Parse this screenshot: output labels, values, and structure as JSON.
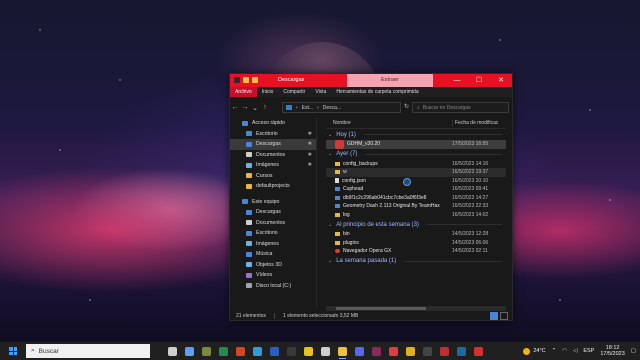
{
  "window": {
    "title": "Descargas",
    "context_tab": "Extraer",
    "controls": {
      "minimize": "—",
      "maximize": "☐",
      "close": "✕"
    }
  },
  "ribbon": {
    "tabs": [
      "Archivo",
      "Inicio",
      "Compartir",
      "Vista",
      "Herramientas de carpeta comprimida"
    ]
  },
  "address": {
    "parts": [
      "Est...",
      "Desca..."
    ],
    "search_placeholder": "Buscar en Descargas"
  },
  "sidebar": {
    "items": [
      {
        "label": "Acceso rápido",
        "icon": "star-icon",
        "color": "#4a86d8",
        "child": false,
        "pinned": false
      },
      {
        "label": "Escritorio",
        "icon": "desktop-icon",
        "color": "#4a86d8",
        "child": true,
        "pinned": true
      },
      {
        "label": "Descargas",
        "icon": "download-icon",
        "color": "#4a86d8",
        "child": true,
        "pinned": true,
        "selected": true
      },
      {
        "label": "Documentos",
        "icon": "document-icon",
        "color": "#cfcfcf",
        "child": true,
        "pinned": true
      },
      {
        "label": "Imágenes",
        "icon": "image-icon",
        "color": "#6fb0e6",
        "child": true,
        "pinned": true
      },
      {
        "label": "Cursos",
        "icon": "folder-icon",
        "color": "#e8b83e",
        "child": true,
        "pinned": false
      },
      {
        "label": "defaultprojects",
        "icon": "folder-icon",
        "color": "#e8b83e",
        "child": true,
        "pinned": false
      },
      {
        "label": "Este equipo",
        "icon": "computer-icon",
        "color": "#4a86d8",
        "child": false,
        "pinned": false
      },
      {
        "label": "Descargas",
        "icon": "download-icon",
        "color": "#4a86d8",
        "child": true,
        "pinned": false
      },
      {
        "label": "Documentos",
        "icon": "document-icon",
        "color": "#cfcfcf",
        "child": true,
        "pinned": false
      },
      {
        "label": "Escritorio",
        "icon": "desktop-icon",
        "color": "#4a86d8",
        "child": true,
        "pinned": false
      },
      {
        "label": "Imágenes",
        "icon": "image-icon",
        "color": "#6fb0e6",
        "child": true,
        "pinned": false
      },
      {
        "label": "Música",
        "icon": "music-icon",
        "color": "#4a86d8",
        "child": true,
        "pinned": false
      },
      {
        "label": "Objetos 3D",
        "icon": "cube-icon",
        "color": "#6fb0e6",
        "child": true,
        "pinned": false
      },
      {
        "label": "Vídeos",
        "icon": "video-icon",
        "color": "#9b6fd8",
        "child": true,
        "pinned": false
      },
      {
        "label": "Disco local (C:)",
        "icon": "drive-icon",
        "color": "#9aa7b3",
        "child": true,
        "pinned": false
      }
    ]
  },
  "columns": {
    "name": "Nombre",
    "date": "Fecha de modificac"
  },
  "groups": [
    {
      "label": "Hoy (1)",
      "rows": [
        {
          "name": "GDHM_v30.20",
          "date": "17/5/2023 16:55",
          "icon": "app",
          "selected": true
        }
      ]
    },
    {
      "label": "Ayer (7)",
      "rows": [
        {
          "name": "config_backups",
          "date": "16/5/2023 14:16",
          "icon": "folder"
        },
        {
          "name": "vi",
          "date": "16/5/2023 19:37",
          "icon": "folder",
          "hover": true
        },
        {
          "name": "config.json",
          "date": "16/5/2023 20:10",
          "icon": "file"
        },
        {
          "name": "Cuphead",
          "date": "16/5/2023 09:41",
          "icon": "exe"
        },
        {
          "name": "db9f1c2c296ab041cbc7cbe3a0f6f3e8",
          "date": "16/5/2023 14:27",
          "icon": "exe"
        },
        {
          "name": "Geometry Dash 2.113 Original By TeamHax",
          "date": "16/5/2023 22:33",
          "icon": "exe"
        },
        {
          "name": "log",
          "date": "16/5/2023 14:02",
          "icon": "folder"
        }
      ]
    },
    {
      "label": "Al principio de esta semana (3)",
      "rows": [
        {
          "name": "bin",
          "date": "14/5/2023 12:28",
          "icon": "folder"
        },
        {
          "name": "plugins",
          "date": "14/5/2023 06:06",
          "icon": "folder"
        },
        {
          "name": "Navegador Opera GX",
          "date": "14/5/2023 02:11",
          "icon": "opera"
        }
      ]
    },
    {
      "label": "La semana pasada (1)",
      "rows": []
    }
  ],
  "status": {
    "count": "21 elementos",
    "selection": "1 elemento seleccionado  3,52 MB"
  },
  "taskbar": {
    "search_placeholder": "Buscar",
    "apps": [
      {
        "icon": "task-view-icon",
        "color": "#cfcfcf"
      },
      {
        "icon": "cortana-icon",
        "color": "#5aa0ff"
      },
      {
        "icon": "minecraft-icon",
        "color": "#7a8a3a"
      },
      {
        "icon": "excel-icon",
        "color": "#1f8f4e"
      },
      {
        "icon": "office-icon",
        "color": "#d24726"
      },
      {
        "icon": "edge-icon",
        "color": "#2b9de0"
      },
      {
        "icon": "word-icon",
        "color": "#2b5fbf"
      },
      {
        "icon": "terminal-icon",
        "color": "#3a3a3a"
      },
      {
        "icon": "chrome-icon",
        "color": "#e9c21c"
      },
      {
        "icon": "cursor-icon",
        "color": "#cfcfcf"
      },
      {
        "icon": "file-explorer-icon",
        "color": "#f0c040"
      },
      {
        "icon": "discord-icon",
        "color": "#5865f2"
      },
      {
        "icon": "app-icon",
        "color": "#8a2a5a"
      },
      {
        "icon": "opera-icon",
        "color": "#e53b3b"
      },
      {
        "icon": "geometry-dash-icon",
        "color": "#e0b020"
      },
      {
        "icon": "obs-icon",
        "color": "#444444"
      },
      {
        "icon": "app2-icon",
        "color": "#c03030"
      },
      {
        "icon": "steam-icon",
        "color": "#1b6aa0"
      },
      {
        "icon": "app3-icon",
        "color": "#d83030"
      }
    ],
    "weather": "24°C",
    "language": "ESP",
    "time": "18:12",
    "date": "17/5/2023"
  }
}
